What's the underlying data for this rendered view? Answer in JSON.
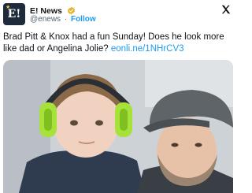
{
  "account": {
    "display_name": "E! News",
    "handle": "@enews",
    "separator": "·",
    "follow_label": "Follow",
    "verified": true,
    "avatar_icon": "e-news-logo-icon",
    "avatar_letter": "E!"
  },
  "tweet": {
    "text": "Brad Pitt & Knox had a fun Sunday! Does he look more like dad or Angelina Jolie? ",
    "link": "eonli.ne/1NHrCV3"
  },
  "icons": {
    "verified": "verified-badge-icon",
    "brand": "x-logo-icon"
  },
  "colors": {
    "accent": "#1d9bf0",
    "verified_badge": "#e8b12a",
    "text_primary": "#0f1419",
    "text_secondary": "#536471",
    "earmuffs": "#a6e23a"
  }
}
